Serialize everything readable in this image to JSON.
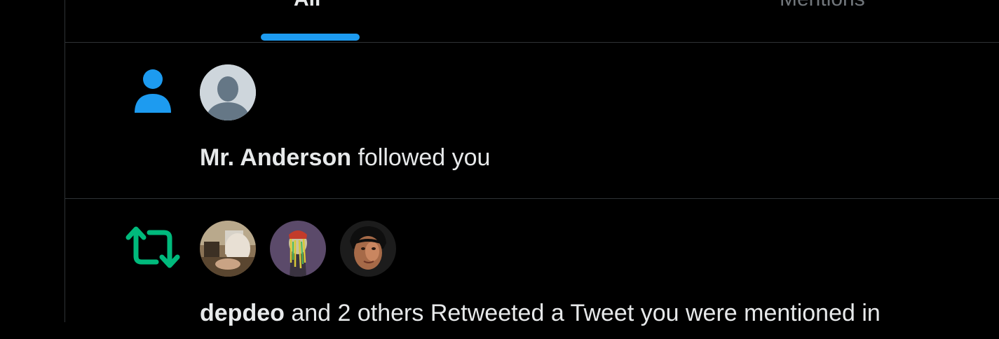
{
  "tabs": [
    {
      "label": "All",
      "active": true
    },
    {
      "label": "Mentions",
      "active": false
    }
  ],
  "notifications": [
    {
      "type": "follow",
      "icon": "person-icon",
      "icon_color": "#1d9bf0",
      "name": "Mr. Anderson",
      "text": " followed you"
    },
    {
      "type": "retweet",
      "icon": "retweet-icon",
      "icon_color": "#00ba7c",
      "name": "depdeo",
      "text": " and 2 others Retweeted a Tweet you were mentioned in"
    }
  ],
  "colors": {
    "accent": "#1d9bf0",
    "retweet": "#00ba7c",
    "background": "#000000",
    "divider": "#2f3336",
    "text": "#e7e9ea",
    "muted": "#71767b"
  }
}
